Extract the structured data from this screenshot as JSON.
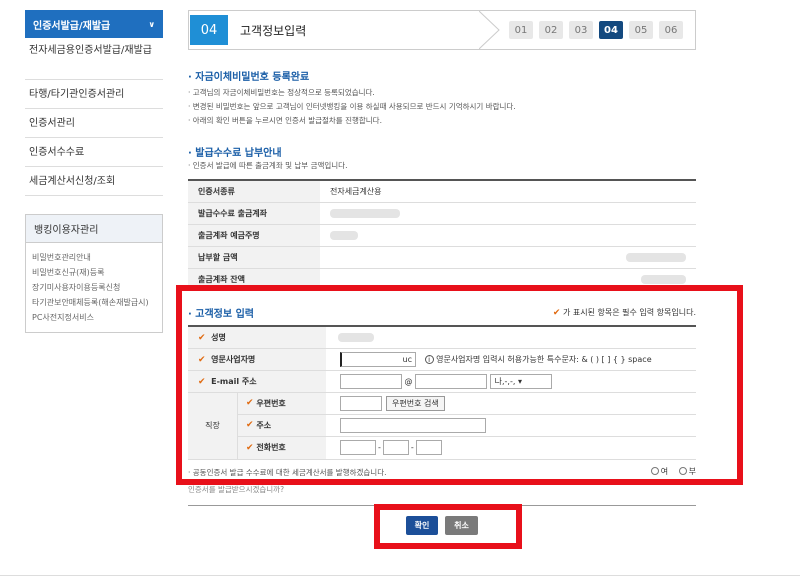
{
  "sidebar": {
    "active": "인증서발급/재발급",
    "items": [
      "전자세금용인증서발급/재발급",
      "타행/타기관인증서관리",
      "인증서관리",
      "인증서수수료",
      "세금계산서신청/조회"
    ],
    "box_title": "뱅킹이용자관리",
    "sub_items": [
      "비밀번호관리안내",
      "비밀번호신규(재)등록",
      "장기미사용자이용등록신청",
      "타기관보안매체등록(해손재발급시)",
      "PC사전지정서비스"
    ]
  },
  "step": {
    "current": "04",
    "title": "고객정보입력",
    "pills": [
      "01",
      "02",
      "03",
      "04",
      "05",
      "06"
    ]
  },
  "password_section": {
    "title": "자금이체비밀번호 등록완료",
    "notes": [
      "고객님의 자금이체비밀번호는 정상적으로 등록되었습니다.",
      "변경된 비밀번호는 앞으로 고객님이 인터넷뱅킹을 이용 하실때 사용되므로 반드시 기억하시기 바랍니다.",
      "아래의 확인 버튼을 누르시면 인증서 발급절차를 진행합니다."
    ]
  },
  "fee_section": {
    "title": "발급수수료 납부안내",
    "note": "인증서 발급에 따른 출금계좌 및 납부 금액입니다.",
    "rows": [
      {
        "label": "인증서종류",
        "value": "전자세금계산용"
      },
      {
        "label": "발급수수료 출금계좌",
        "value": ""
      },
      {
        "label": "출금계좌 예금주명",
        "value": ""
      },
      {
        "label": "납부할 금액",
        "value": ""
      },
      {
        "label": "출금계좌 잔액",
        "value": ""
      }
    ]
  },
  "customer_section": {
    "title": "고객정보 입력",
    "required_note": "가 표시된 항목은 필수 입력 항목입니다.",
    "name_label": "성명",
    "eng_name_label": "영문사업자명",
    "eng_name_suffix": "uc",
    "eng_name_hint": "영문사업자명 입력시 허용가능한 특수문자: & ( ) [ ] { } space",
    "email_label": "E-mail 주소",
    "email_at": "@",
    "email_select": "나,-,-,",
    "workplace_label": "직장",
    "zip_label": "우편번호",
    "zip_button": "우편번호 검색",
    "address_label": "주소",
    "phone_label": "전화번호",
    "tax_question": "공동인증서 발급 수수료에 대한 세금계산서를 발행하겠습니다.",
    "radio_yes": "여",
    "radio_no": "부",
    "confirm_question": "인증서를 발급받으시겠습니까?"
  },
  "buttons": {
    "ok": "확인",
    "cancel": "취소"
  },
  "colors": {
    "accent": "#1f6fbf",
    "highlight": "#e8101a"
  }
}
